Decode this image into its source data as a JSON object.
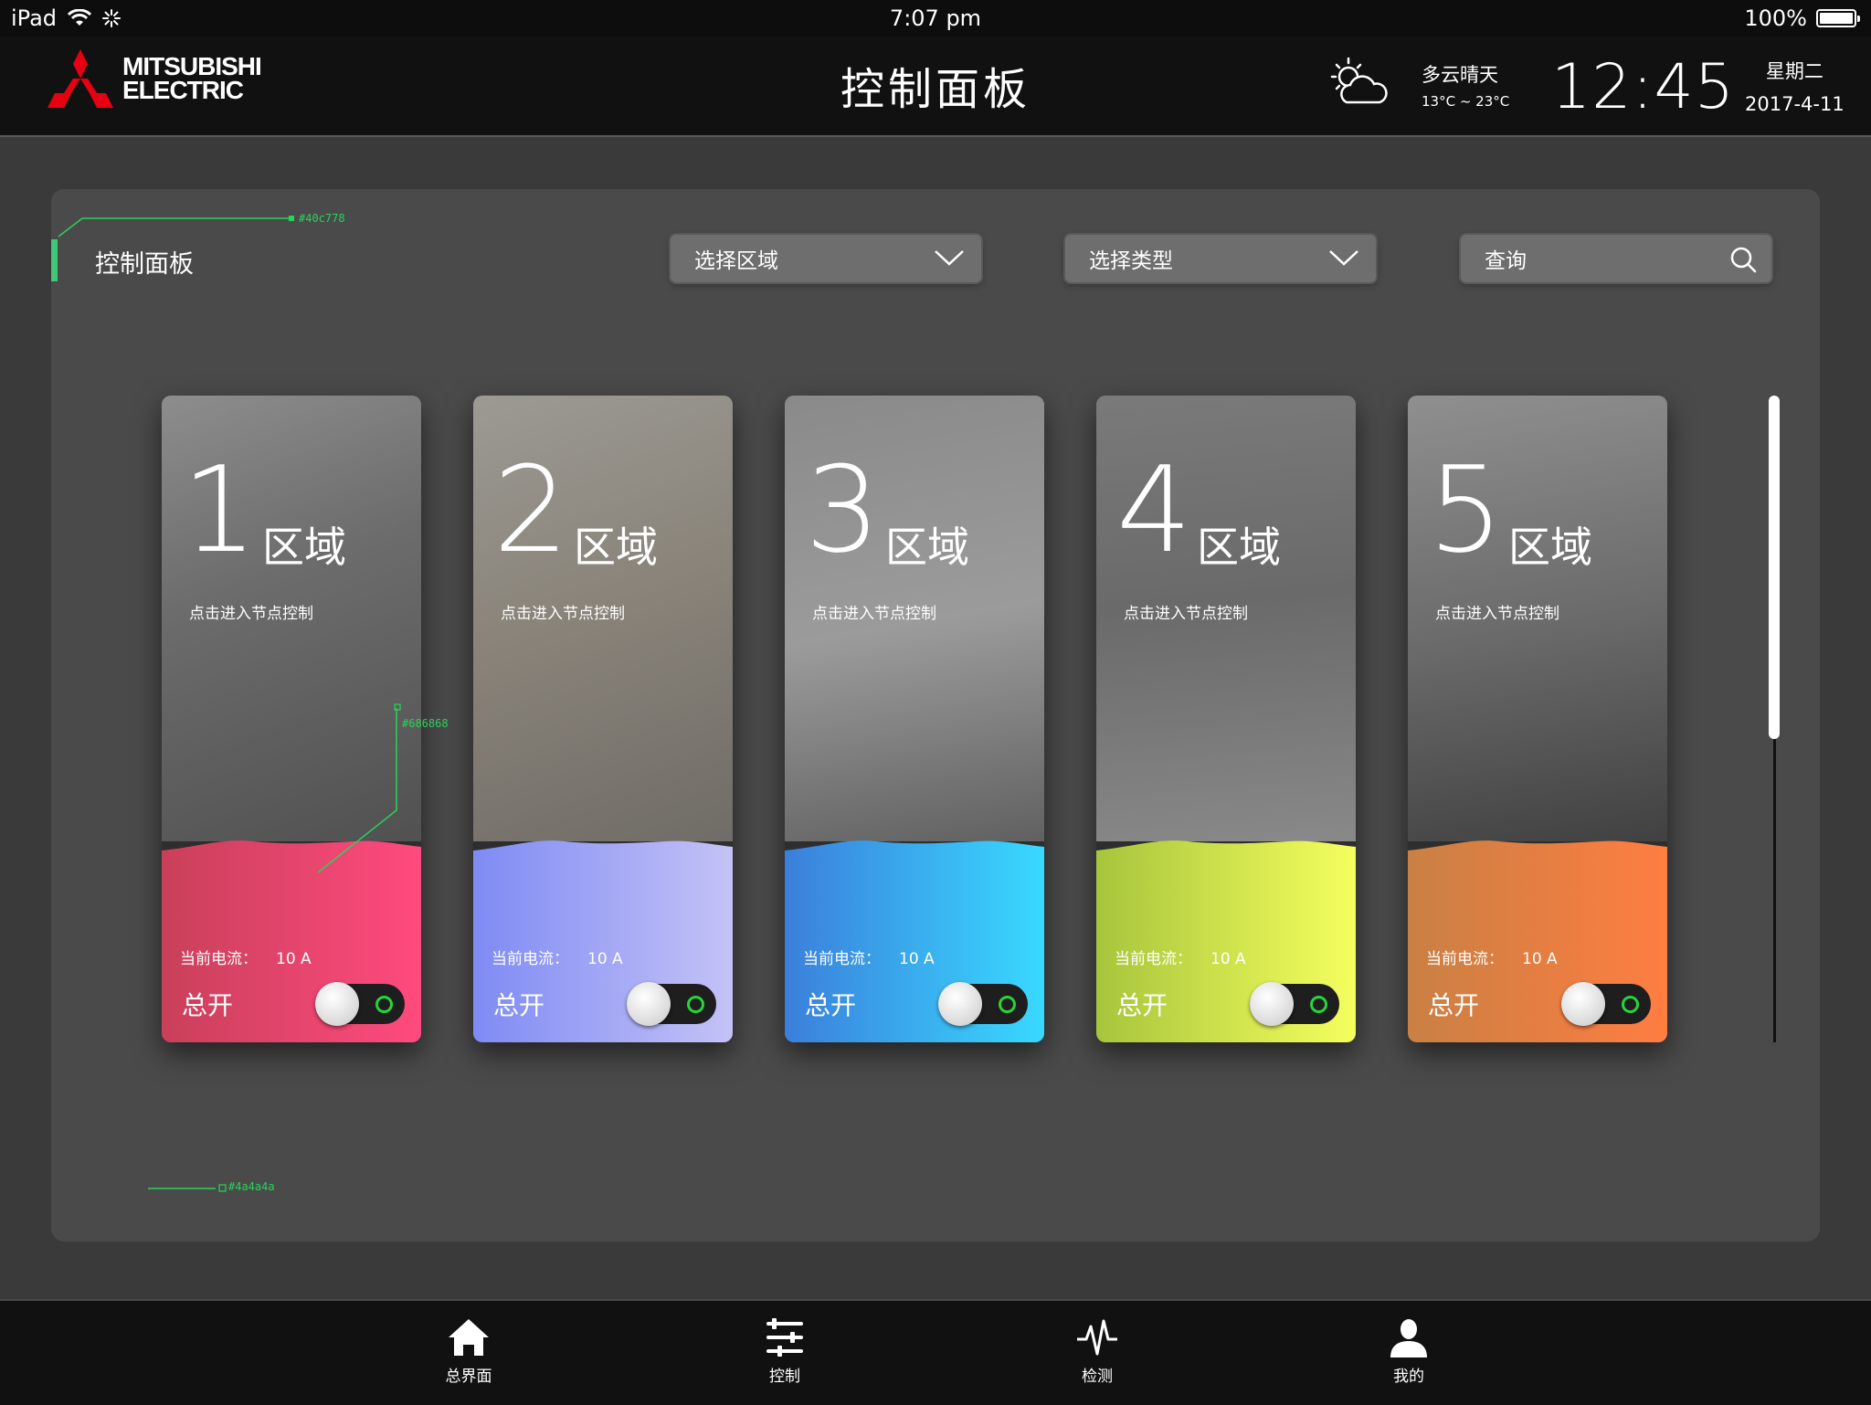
{
  "status_bar": {
    "device": "iPad",
    "time": "7:07 pm",
    "battery": "100%"
  },
  "header": {
    "brand_line1": "MITSUBISHI",
    "brand_line2": "ELECTRIC",
    "title": "控制面板",
    "weather": {
      "desc": "多云晴天",
      "temp": "13°C ~ 23°C",
      "icon": "partly-cloudy-icon"
    },
    "clock": "12:45",
    "weekday": "星期二",
    "date": "2017-4-11"
  },
  "panel": {
    "title": "控制面板",
    "annotations": {
      "accent": "#40c778",
      "card_shade": "#686868",
      "panel_bg": "#4a4a4a"
    },
    "region_select": {
      "label": "选择区域"
    },
    "type_select": {
      "label": "选择类型"
    },
    "search": {
      "label": "查询"
    }
  },
  "cards": [
    {
      "number": "1",
      "zone": "区域",
      "hint": "点击进入节点控制",
      "current_label": "当前电流：",
      "current_value": "10 A",
      "master": "总开",
      "colors": [
        "#c9405a",
        "#ff4a7e"
      ],
      "toggle_on": true
    },
    {
      "number": "2",
      "zone": "区域",
      "hint": "点击进入节点控制",
      "current_label": "当前电流：",
      "current_value": "10 A",
      "master": "总开",
      "colors": [
        "#7f8bf4",
        "#c4c2f6"
      ],
      "toggle_on": true
    },
    {
      "number": "3",
      "zone": "区域",
      "hint": "点击进入节点控制",
      "current_label": "当前电流：",
      "current_value": "10 A",
      "master": "总开",
      "colors": [
        "#3b7fdb",
        "#39d9ff"
      ],
      "toggle_on": true
    },
    {
      "number": "4",
      "zone": "区域",
      "hint": "点击进入节点控制",
      "current_label": "当前电流：",
      "current_value": "10 A",
      "master": "总开",
      "colors": [
        "#a7c53c",
        "#f5ff5e"
      ],
      "toggle_on": true
    },
    {
      "number": "5",
      "zone": "区域",
      "hint": "点击进入节点控制",
      "current_label": "当前电流：",
      "current_value": "10 A",
      "master": "总开",
      "colors": [
        "#c98044",
        "#ff7d41"
      ],
      "toggle_on": true
    }
  ],
  "tabs": [
    {
      "label": "总界面",
      "icon": "home-icon"
    },
    {
      "label": "控制",
      "icon": "sliders-icon"
    },
    {
      "label": "检测",
      "icon": "pulse-icon"
    },
    {
      "label": "我的",
      "icon": "user-icon"
    }
  ]
}
